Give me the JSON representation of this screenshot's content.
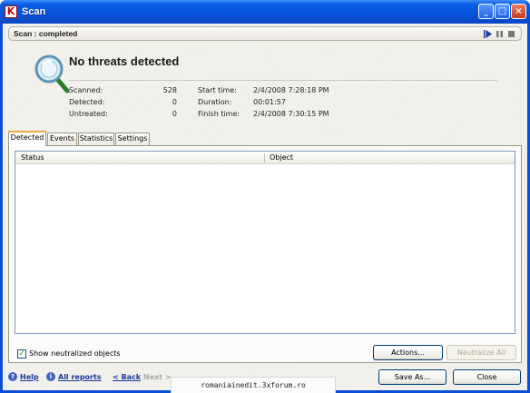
{
  "window": {
    "title": "Scan"
  },
  "status": {
    "text": "Scan : completed"
  },
  "result": {
    "headline": "No threats detected"
  },
  "stats": {
    "scanned_label": "Scanned:",
    "scanned_value": "528",
    "detected_label": "Detected:",
    "detected_value": "0",
    "untreated_label": "Untreated:",
    "untreated_value": "0",
    "start_label": "Start time:",
    "start_value": "2/4/2008 7:28:18 PM",
    "duration_label": "Duration:",
    "duration_value": "00:01:57",
    "finish_label": "Finish time:",
    "finish_value": "2/4/2008 7:30:15 PM"
  },
  "tabs": [
    "Detected",
    "Events",
    "Statistics",
    "Settings"
  ],
  "list": {
    "columns": [
      "Status",
      "Object"
    ]
  },
  "options": {
    "show_neutralized": "Show neutralized objects",
    "show_neutralized_checked": true
  },
  "buttons": {
    "actions": "Actions...",
    "neutralize_all": "Neutralize All",
    "save_as": "Save As...",
    "close": "Close"
  },
  "footer": {
    "help": "Help",
    "all_reports": "All reports",
    "back": "< Back",
    "next": "Next >"
  },
  "watermark": "romaniainedit.3xforum.ro",
  "colors": {
    "titlebar": "#0a4ed4",
    "link": "#1b3a9a",
    "accent_tab": "#f0a848"
  },
  "icons": [
    "app-icon",
    "minimize-icon",
    "maximize-icon",
    "close-icon",
    "play-icon",
    "pause-icon",
    "stop-icon",
    "magnifier-icon",
    "help-icon",
    "reports-icon"
  ]
}
